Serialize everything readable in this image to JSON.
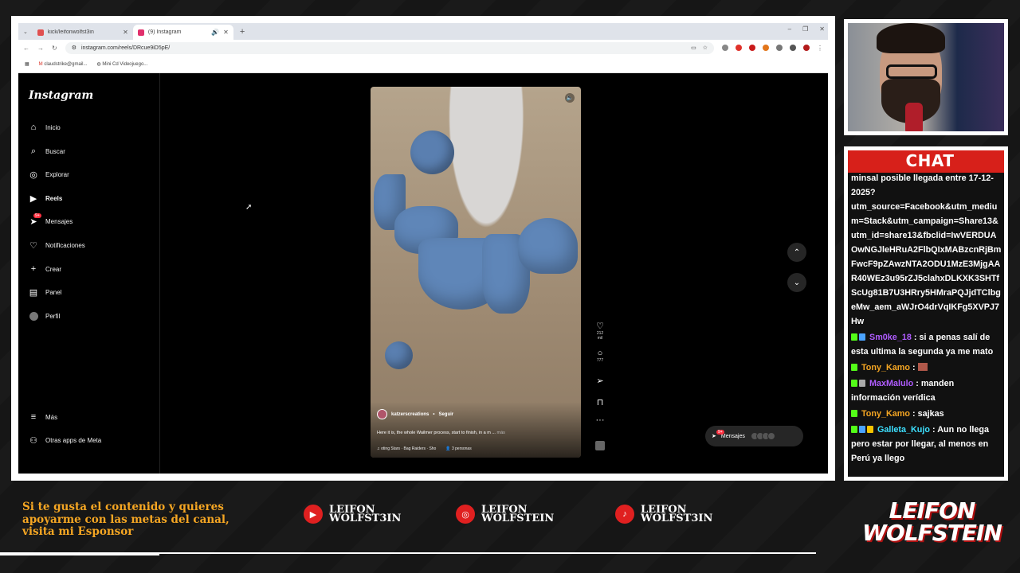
{
  "browser": {
    "tabs": [
      {
        "title": "kick/leifonwolfst3in",
        "active": false,
        "fav_color": "#53fc18"
      },
      {
        "title": "(9) Instagram",
        "active": true,
        "fav_color": "#e1306c"
      }
    ],
    "url": "instagram.com/reels/DRcue9iD5pE/",
    "bookmarks": [
      "claudstrike@gmail...",
      "Mini Cd Videojuego..."
    ]
  },
  "instagram": {
    "logo": "Instagram",
    "nav": [
      {
        "label": "Inicio",
        "icon": "home-icon"
      },
      {
        "label": "Buscar",
        "icon": "search-icon"
      },
      {
        "label": "Explorar",
        "icon": "compass-icon"
      },
      {
        "label": "Reels",
        "icon": "reels-icon",
        "active": true
      },
      {
        "label": "Mensajes",
        "icon": "messenger-icon",
        "badge": "9+"
      },
      {
        "label": "Notificaciones",
        "icon": "heart-icon"
      },
      {
        "label": "Crear",
        "icon": "plus-icon"
      },
      {
        "label": "Panel",
        "icon": "dashboard-icon"
      },
      {
        "label": "Perfil",
        "icon": "avatar-icon"
      }
    ],
    "nav_bottom": [
      {
        "label": "Más",
        "icon": "menu-icon"
      },
      {
        "label": "Otras apps de Meta",
        "icon": "meta-apps-icon"
      }
    ],
    "reel": {
      "author": "katzerscreations",
      "follow": "Seguir",
      "caption": "Here it is, the whole Wailmer process, start to finish, in a m ...",
      "more": "más",
      "music": "oting Stars · Bag Raiders · Sho",
      "people": "3 personas",
      "likes": "212 mil",
      "comments": "777"
    },
    "messages_pill": {
      "label": "Mensajes",
      "badge": "9+"
    }
  },
  "chat": {
    "title": "CHAT",
    "messages": [
      {
        "user": "",
        "text": "minsal posible llegada entre 17-12-2025? utm_source=Facebook&utm_medium=Stack&utm_campaign=Share13&utm_id=share13&fbclid=IwVERDUAOwNGJleHRuA2FlbQIxMABzcnRjBmFwcF9pZAwzNTA2ODU1MzE3MjgAAR40WEz3u95rZJ5clahxDLKXK3SHTfScUg81B7U3HRry5HMraPQJjdTClbgeMw_aem_aWJrO4drVqIKFg5XVPJ7Hw",
        "color": "#ffffff"
      },
      {
        "user": "Sm0ke_18",
        "text": "si a penas salí de esta ultima la segunda ya me mato",
        "color": "#b05cff"
      },
      {
        "user": "Tony_Kamo",
        "text": "",
        "color": "#f5a623"
      },
      {
        "user": "MaxMalulo",
        "text": "manden información verídica",
        "color": "#b05cff"
      },
      {
        "user": "Tony_Kamo",
        "text": "sajkas",
        "color": "#f5a623"
      },
      {
        "user": "Galleta_Kujo",
        "text": "Aun no llega pero estar por llegar, al menos en Perú ya llego",
        "color": "#3de0ff"
      }
    ]
  },
  "banner": {
    "support_lines": [
      "Si te gusta el contenido y quieres",
      "apoyarme con las metas del canal,",
      "visita mi Esponsor"
    ],
    "socials": [
      {
        "network": "youtube",
        "icon": "youtube-icon",
        "line1": "LEIFON",
        "line2": "WOLFST3IN"
      },
      {
        "network": "instagram",
        "icon": "instagram-icon",
        "line1": "LEIFON",
        "line2": "WOLFSTEIN"
      },
      {
        "network": "tiktok",
        "icon": "tiktok-icon",
        "line1": "LEIFON",
        "line2": "WOLFST3IN"
      }
    ],
    "brand_line1": "LEIFON",
    "brand_line2": "WOLFSTEIN"
  }
}
